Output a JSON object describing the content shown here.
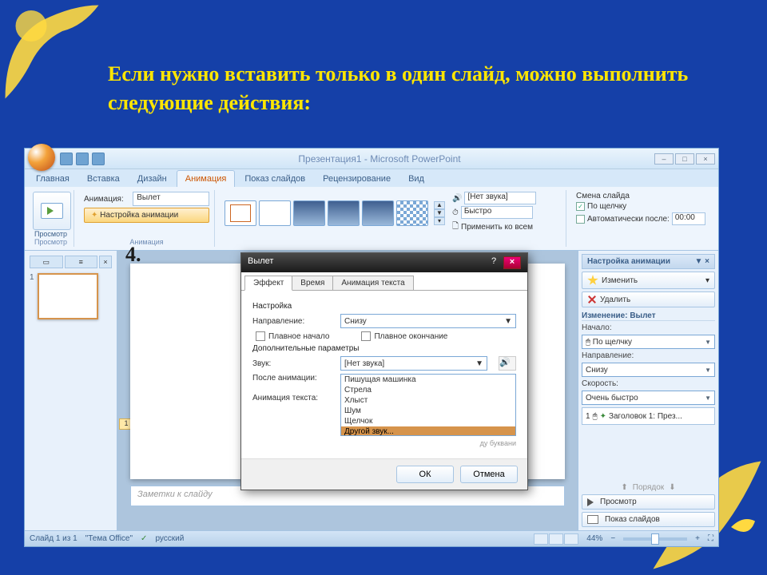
{
  "slide_title": "Если нужно вставить только в один слайд, можно  выполнить следующие действия:",
  "step_number": "4.",
  "window": {
    "title": "Презентация1 - Microsoft PowerPoint"
  },
  "ribbon": {
    "tabs": [
      "Главная",
      "Вставка",
      "Дизайн",
      "Анимация",
      "Показ слайдов",
      "Рецензирование",
      "Вид"
    ],
    "active_tab": "Анимация",
    "preview_label": "Просмотр",
    "preview_group": "Просмотр",
    "anim_label": "Анимация:",
    "anim_value": "Вылет",
    "custom_anim_btn": "Настройка анимации",
    "anim_group": "Анимация",
    "sound_lbl": "[Нет звука]",
    "speed_lbl": "Быстро",
    "apply_all": "Применить ко всем",
    "advance_title": "Смена слайда",
    "on_click": "По щелчку",
    "auto_after": "Автоматически после:",
    "auto_time": "00:00"
  },
  "workspace": {
    "slide_number": "1",
    "ruler_marker": "1",
    "notes_placeholder": "Заметки к слайду"
  },
  "task_pane": {
    "title": "Настройка анимации",
    "change_btn": "Изменить",
    "delete_btn": "Удалить",
    "modification": "Изменение: Вылет",
    "start_label": "Начало:",
    "start_value": "По щелчку",
    "direction_label": "Направление:",
    "direction_value": "Снизу",
    "speed_label": "Скорость:",
    "speed_value": "Очень быстро",
    "anim_item_num": "1",
    "anim_item": "Заголовок 1: През...",
    "reorder": "Порядок",
    "preview_btn": "Просмотр",
    "slideshow_btn": "Показ слайдов"
  },
  "status": {
    "slide_info": "Слайд 1 из 1",
    "theme": "\"Тема Office\"",
    "language": "русский",
    "zoom": "44%"
  },
  "dialog": {
    "title": "Вылет",
    "tabs": [
      "Эффект",
      "Время",
      "Анимация текста"
    ],
    "section_settings": "Настройка",
    "direction_label": "Направление:",
    "direction_value": "Снизу",
    "smooth_start": "Плавное начало",
    "smooth_end": "Плавное окончание",
    "section_extra": "Дополнительные параметры",
    "sound_label": "Звук:",
    "sound_value": "[Нет звука]",
    "after_label": "После анимации:",
    "text_label": "Анимация текста:",
    "delay_hint": "ду буквани",
    "options": [
      "Пишущая машинка",
      "Стрела",
      "Хлыст",
      "Шум",
      "Щелчок",
      "Другой звук..."
    ],
    "ok": "ОК",
    "cancel": "Отмена"
  }
}
